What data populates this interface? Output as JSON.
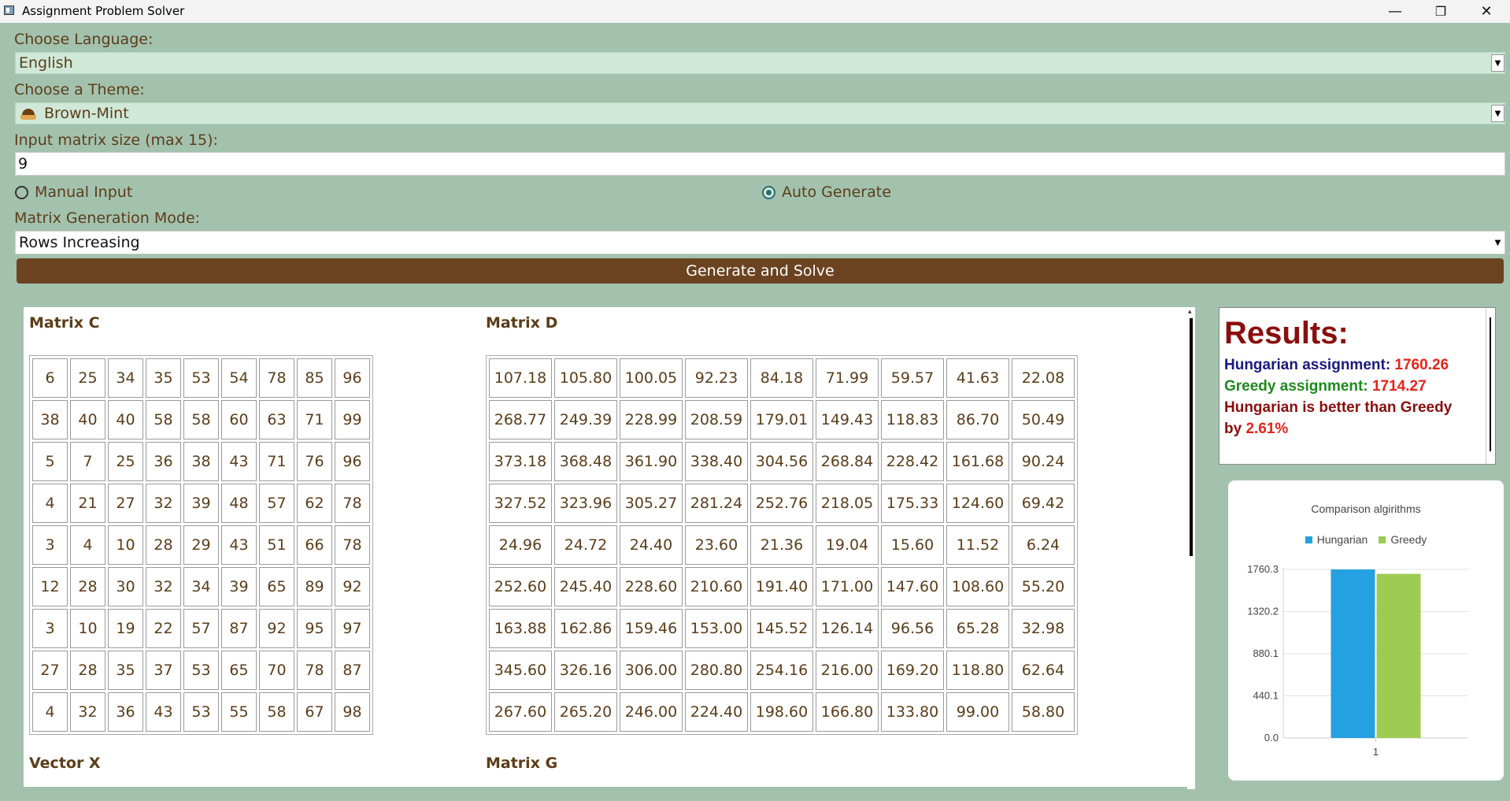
{
  "window": {
    "title": "Assignment Problem Solver",
    "minimize": "—",
    "restore": "❐",
    "close": "✕"
  },
  "form": {
    "language_label": "Choose Language:",
    "language_value": "English",
    "theme_label": "Choose a Theme:",
    "theme_value": "Brown-Mint",
    "size_label": "Input matrix size (max 15):",
    "size_value": "9",
    "radio_manual": "Manual Input",
    "radio_auto": "Auto Generate",
    "radio_selected": "auto",
    "mode_label": "Matrix Generation Mode:",
    "mode_value": "Rows Increasing",
    "generate_button": "Generate and Solve"
  },
  "matrices": {
    "c_title": "Matrix C",
    "d_title": "Matrix D",
    "x_title": "Vector X",
    "g_title": "Matrix G",
    "C": [
      [
        "6",
        "25",
        "34",
        "35",
        "53",
        "54",
        "78",
        "85",
        "96"
      ],
      [
        "38",
        "40",
        "40",
        "58",
        "58",
        "60",
        "63",
        "71",
        "99"
      ],
      [
        "5",
        "7",
        "25",
        "36",
        "38",
        "43",
        "71",
        "76",
        "96"
      ],
      [
        "4",
        "21",
        "27",
        "32",
        "39",
        "48",
        "57",
        "62",
        "78"
      ],
      [
        "3",
        "4",
        "10",
        "28",
        "29",
        "43",
        "51",
        "66",
        "78"
      ],
      [
        "12",
        "28",
        "30",
        "32",
        "34",
        "39",
        "65",
        "89",
        "92"
      ],
      [
        "3",
        "10",
        "19",
        "22",
        "57",
        "87",
        "92",
        "95",
        "97"
      ],
      [
        "27",
        "28",
        "35",
        "37",
        "53",
        "65",
        "70",
        "78",
        "87"
      ],
      [
        "4",
        "32",
        "36",
        "43",
        "53",
        "55",
        "58",
        "67",
        "98"
      ]
    ],
    "D": [
      [
        "107.18",
        "105.80",
        "100.05",
        "92.23",
        "84.18",
        "71.99",
        "59.57",
        "41.63",
        "22.08"
      ],
      [
        "268.77",
        "249.39",
        "228.99",
        "208.59",
        "179.01",
        "149.43",
        "118.83",
        "86.70",
        "50.49"
      ],
      [
        "373.18",
        "368.48",
        "361.90",
        "338.40",
        "304.56",
        "268.84",
        "228.42",
        "161.68",
        "90.24"
      ],
      [
        "327.52",
        "323.96",
        "305.27",
        "281.24",
        "252.76",
        "218.05",
        "175.33",
        "124.60",
        "69.42"
      ],
      [
        "24.96",
        "24.72",
        "24.40",
        "23.60",
        "21.36",
        "19.04",
        "15.60",
        "11.52",
        "6.24"
      ],
      [
        "252.60",
        "245.40",
        "228.60",
        "210.60",
        "191.40",
        "171.00",
        "147.60",
        "108.60",
        "55.20"
      ],
      [
        "163.88",
        "162.86",
        "159.46",
        "153.00",
        "145.52",
        "126.14",
        "96.56",
        "65.28",
        "32.98"
      ],
      [
        "345.60",
        "326.16",
        "306.00",
        "280.80",
        "254.16",
        "216.00",
        "169.20",
        "118.80",
        "62.64"
      ],
      [
        "267.60",
        "265.20",
        "246.00",
        "224.40",
        "198.60",
        "166.80",
        "133.80",
        "99.00",
        "58.80"
      ]
    ]
  },
  "results": {
    "title": "Results:",
    "hungarian_label": "Hungarian assignment: ",
    "hungarian_value": "1760.26",
    "greedy_label": "Greedy assignment: ",
    "greedy_value": "1714.27",
    "compare_text": "Hungarian is better than Greedy",
    "by_label": "by ",
    "percent": "2.61%"
  },
  "chart_data": {
    "type": "bar",
    "title": "Comparison algirithms",
    "categories": [
      "1"
    ],
    "series": [
      {
        "name": "Hungarian",
        "values": [
          1760.26
        ],
        "color": "#25a0e0"
      },
      {
        "name": "Greedy",
        "values": [
          1714.27
        ],
        "color": "#9ccc52"
      }
    ],
    "yticks": [
      "1760.3",
      "1320.2",
      "880.1",
      "440.1",
      "0.0"
    ],
    "ylim": [
      0,
      1760.3
    ],
    "grid": true,
    "legend": "top"
  }
}
